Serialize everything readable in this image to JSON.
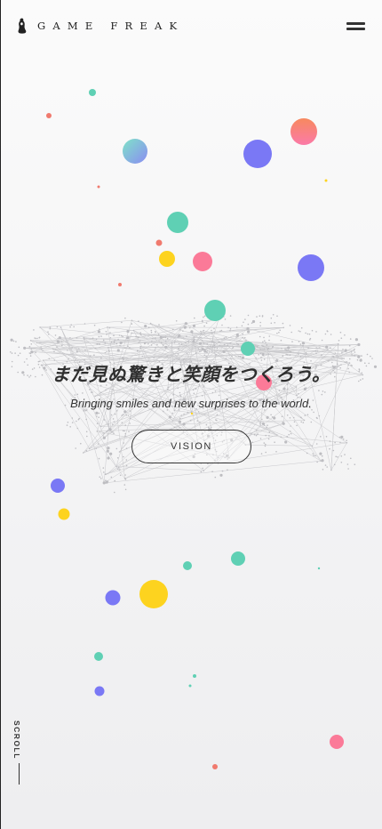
{
  "header": {
    "logo_text": "GAME FREAK",
    "menu_icon": "hamburger-menu-icon"
  },
  "hero": {
    "title": "まだ見ぬ驚きと笑顔をつくろう。",
    "subtitle": "Bringing smiles and new surprises to the world.",
    "vision_button_label": "VISION"
  },
  "scroll": {
    "label": "SCROLL"
  },
  "colors": {
    "teal": "#5fd0b4",
    "coral": "#f07a6e",
    "yellow": "#fdd31f",
    "violet": "#7a78f5",
    "pink": "#fb7a98",
    "text_dark": "#2f2f2f"
  }
}
